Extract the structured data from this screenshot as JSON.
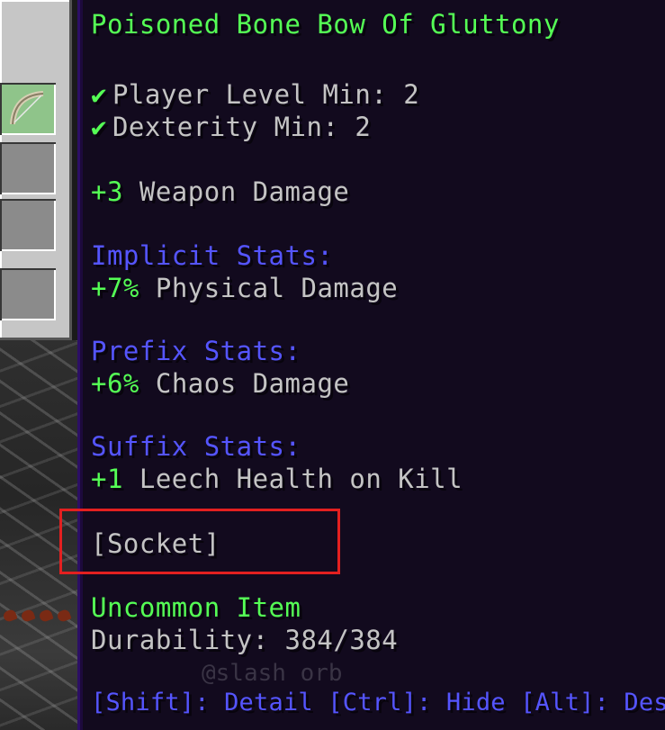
{
  "tooltip": {
    "item_name": "Poisoned Bone Bow Of Gluttony",
    "requirements": [
      {
        "icon": "check-icon",
        "glyph": "✔",
        "text": "Player Level Min: 2"
      },
      {
        "icon": "check-icon",
        "glyph": "✔",
        "text": "Dexterity Min: 2"
      }
    ],
    "weapon_damage": {
      "value": "+3",
      "label": "Weapon Damage"
    },
    "implicit": {
      "header": "Implicit Stats:",
      "value": "+7%",
      "label": "Physical Damage"
    },
    "prefix": {
      "header": "Prefix Stats:",
      "value": "+6%",
      "label": "Chaos Damage"
    },
    "suffix": {
      "header": "Suffix Stats:",
      "value": "+1",
      "label": "Leech Health on Kill"
    },
    "socket": "[Socket]",
    "rarity": "Uncommon Item",
    "durability": "Durability: 384/384",
    "hint": "[Shift]: Detail [Ctrl]: Hide [Alt]: Desc",
    "watermark": "@slash orb"
  },
  "inventory": {
    "selected_item_icon": "bone-bow-icon"
  },
  "colors": {
    "tooltip_bg": "#120a1e",
    "tooltip_border": "#2c0f64",
    "green": "#55ff55",
    "gray": "#c4c4c4",
    "blue": "#5555ff",
    "highlight": "#e32020"
  }
}
